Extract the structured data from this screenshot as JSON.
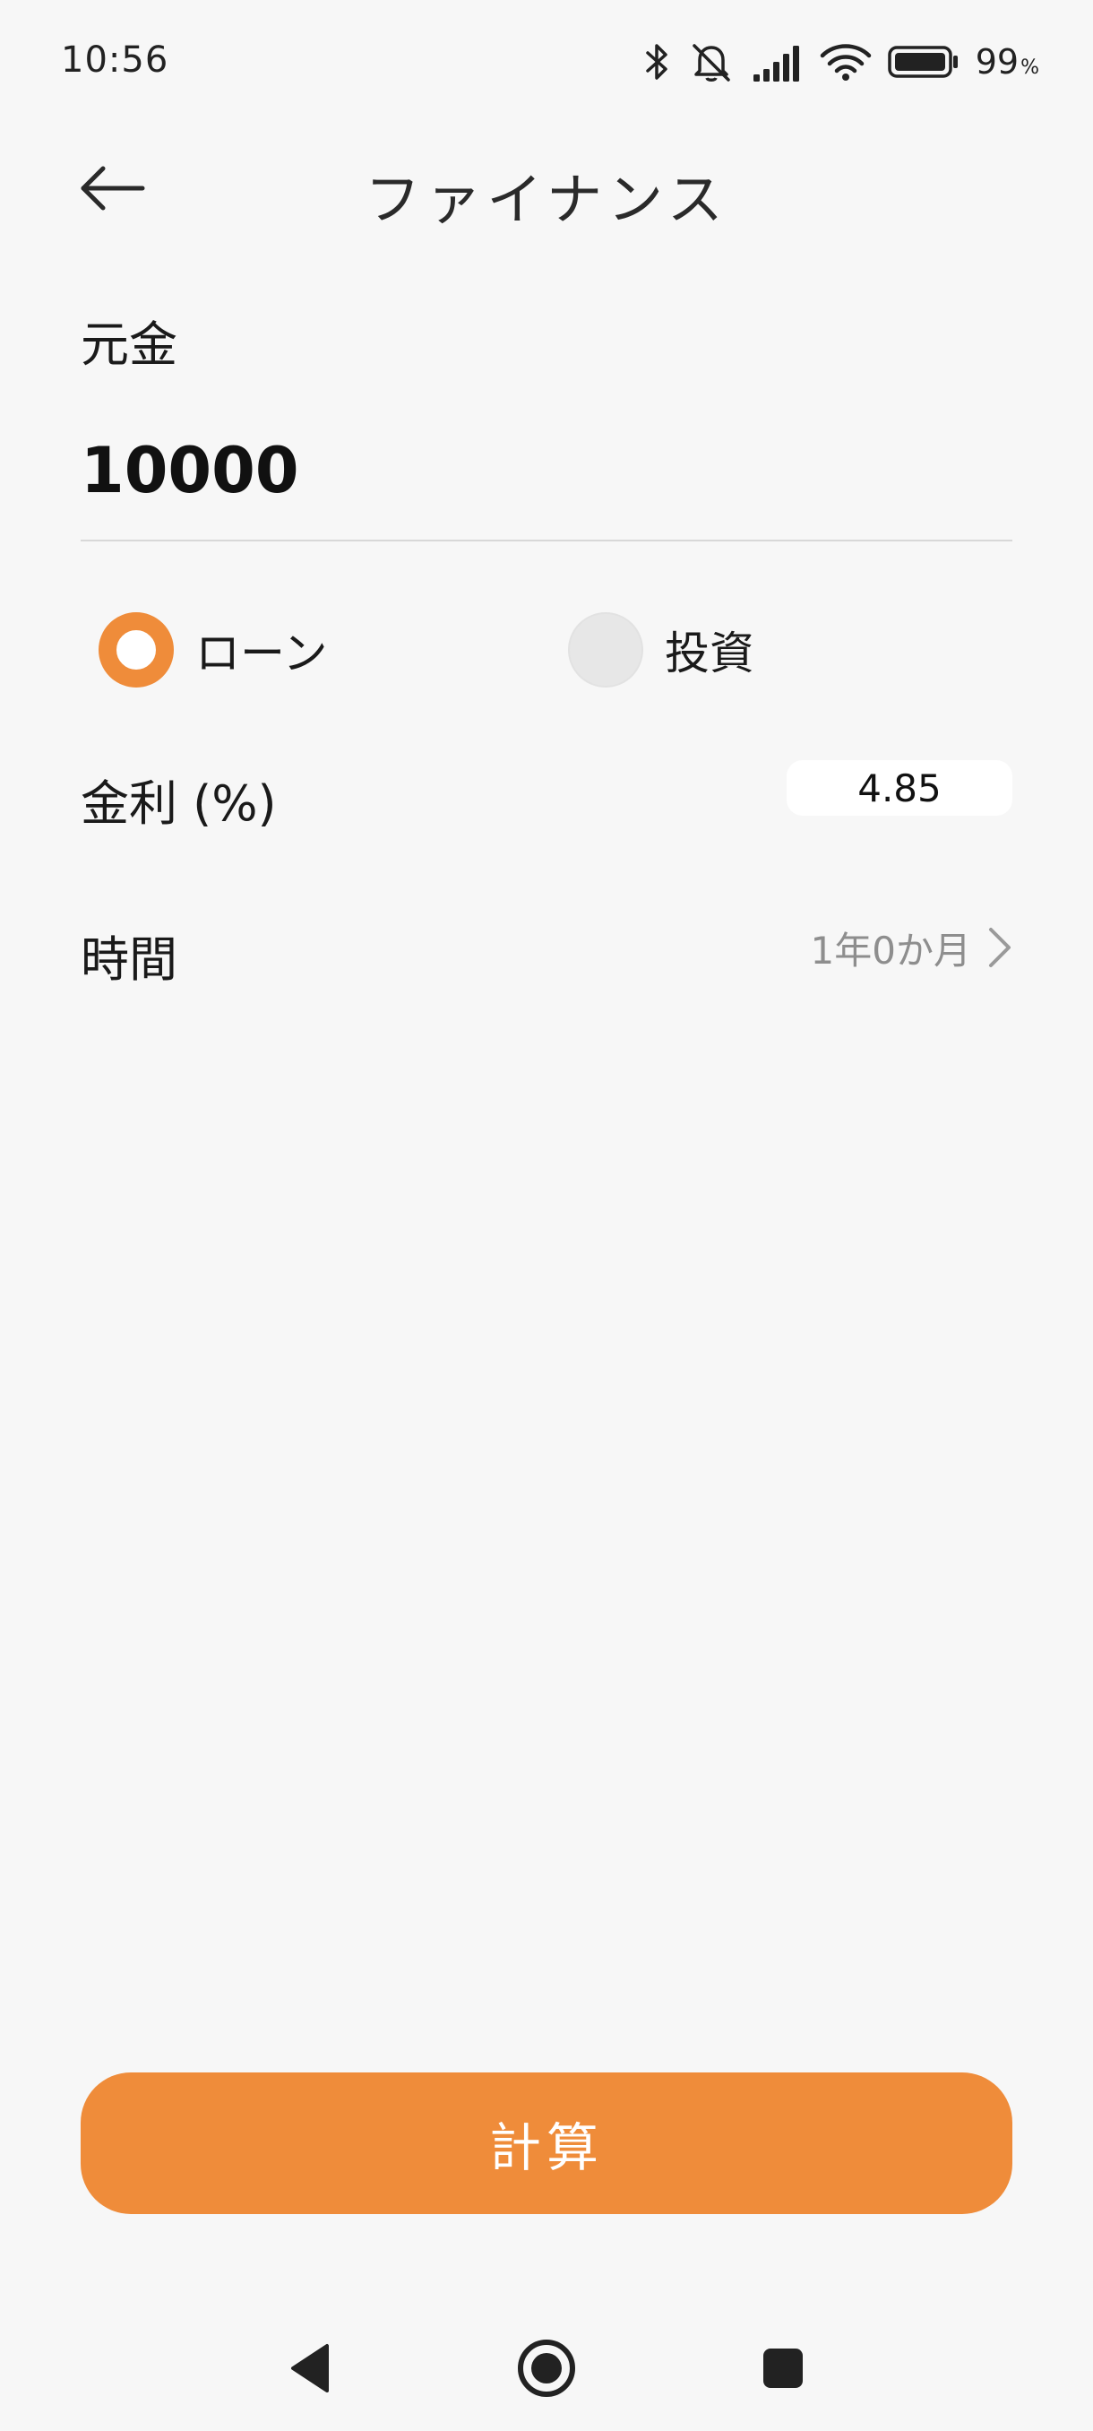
{
  "status_bar": {
    "time": "10:56",
    "battery_percent": "99",
    "battery_unit": "%",
    "icons": [
      "bluetooth-icon",
      "muted-bell-icon",
      "signal-icon",
      "wifi-icon",
      "battery-icon"
    ]
  },
  "app_bar": {
    "title": "ファイナンス",
    "back_icon": "arrow-left-icon"
  },
  "principal": {
    "label": "元金",
    "value": "10000"
  },
  "mode": {
    "options": [
      {
        "label": "ローン",
        "selected": true
      },
      {
        "label": "投資",
        "selected": false
      }
    ]
  },
  "interest": {
    "label": "金利 (%)",
    "value": "4.85"
  },
  "duration": {
    "label": "時間",
    "value": "1年0か月"
  },
  "calculate": {
    "label": "計算"
  },
  "colors": {
    "accent": "#ef8c3a",
    "background": "#f7f7f7"
  }
}
